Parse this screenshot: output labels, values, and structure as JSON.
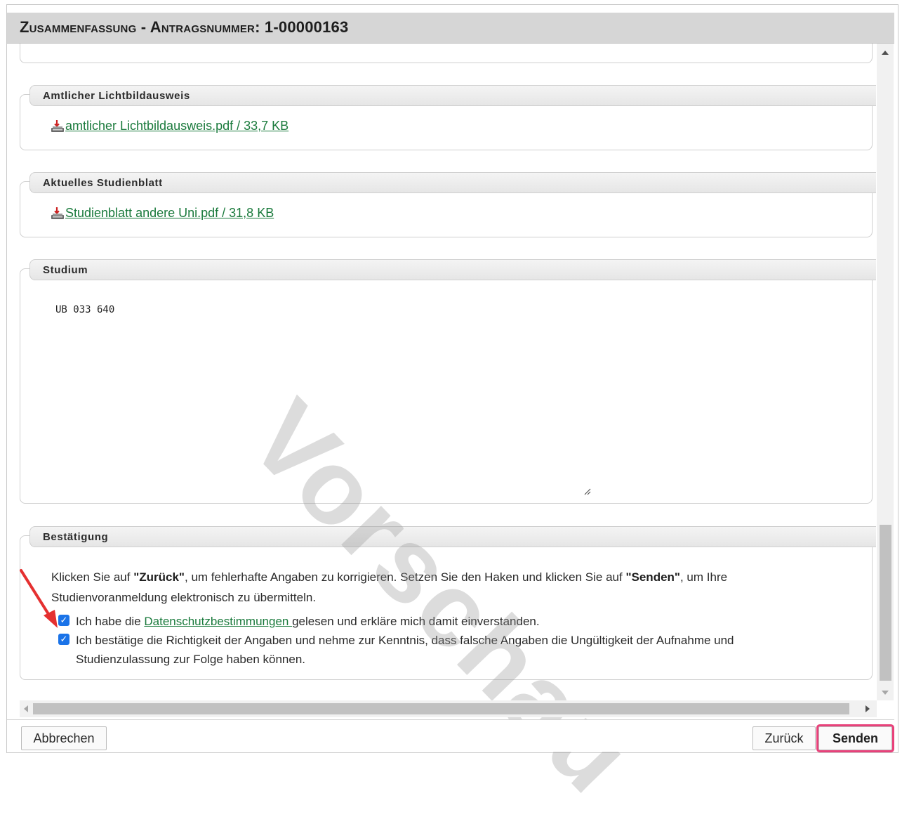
{
  "dialog": {
    "title": "Zusammenfassung - Antragsnummer: 1-00000163"
  },
  "sections": {
    "lichtbildausweis": {
      "legend": "Amtlicher Lichtbildausweis",
      "file_link": "amtlicher Lichtbildausweis.pdf / 33,7 KB"
    },
    "studienblatt": {
      "legend": "Aktuelles Studienblatt",
      "file_link": "Studienblatt andere Uni.pdf / 31,8 KB"
    },
    "studium": {
      "legend": "Studium",
      "value": "UB 033 640"
    },
    "bestaetigung": {
      "legend": "Bestätigung",
      "text_part1": "Klicken Sie auf ",
      "text_zurueck": "\"Zurück\"",
      "text_part2": ", um fehlerhafte Angaben zu korrigieren. Setzen Sie den Haken und klicken Sie auf ",
      "text_senden": "\"Senden\"",
      "text_part3": ", um Ihre Studienvoranmeldung elektronisch zu übermitteln.",
      "checkbox1_prefix": "Ich habe die ",
      "checkbox1_link": "Datenschutzbestimmungen ",
      "checkbox1_suffix": "gelesen und erkläre mich damit einverstanden.",
      "checkbox1_checked": true,
      "checkbox2_label": "Ich bestätige die Richtigkeit der Angaben und nehme zur Kenntnis, dass falsche Angaben die Ungültigkeit der Aufnahme und Studienzulassung zur Folge haben können.",
      "checkbox2_checked": true
    }
  },
  "watermark": "Vorschau",
  "footer": {
    "cancel_label": "Abbrechen",
    "back_label": "Zurück",
    "send_label": "Senden"
  },
  "colors": {
    "link_green": "#1a7a3c",
    "checkbox_blue": "#1a73e8",
    "highlight_pink": "#e8417a",
    "annotation_red": "#e53030"
  },
  "icons": {
    "download": "download-icon"
  }
}
